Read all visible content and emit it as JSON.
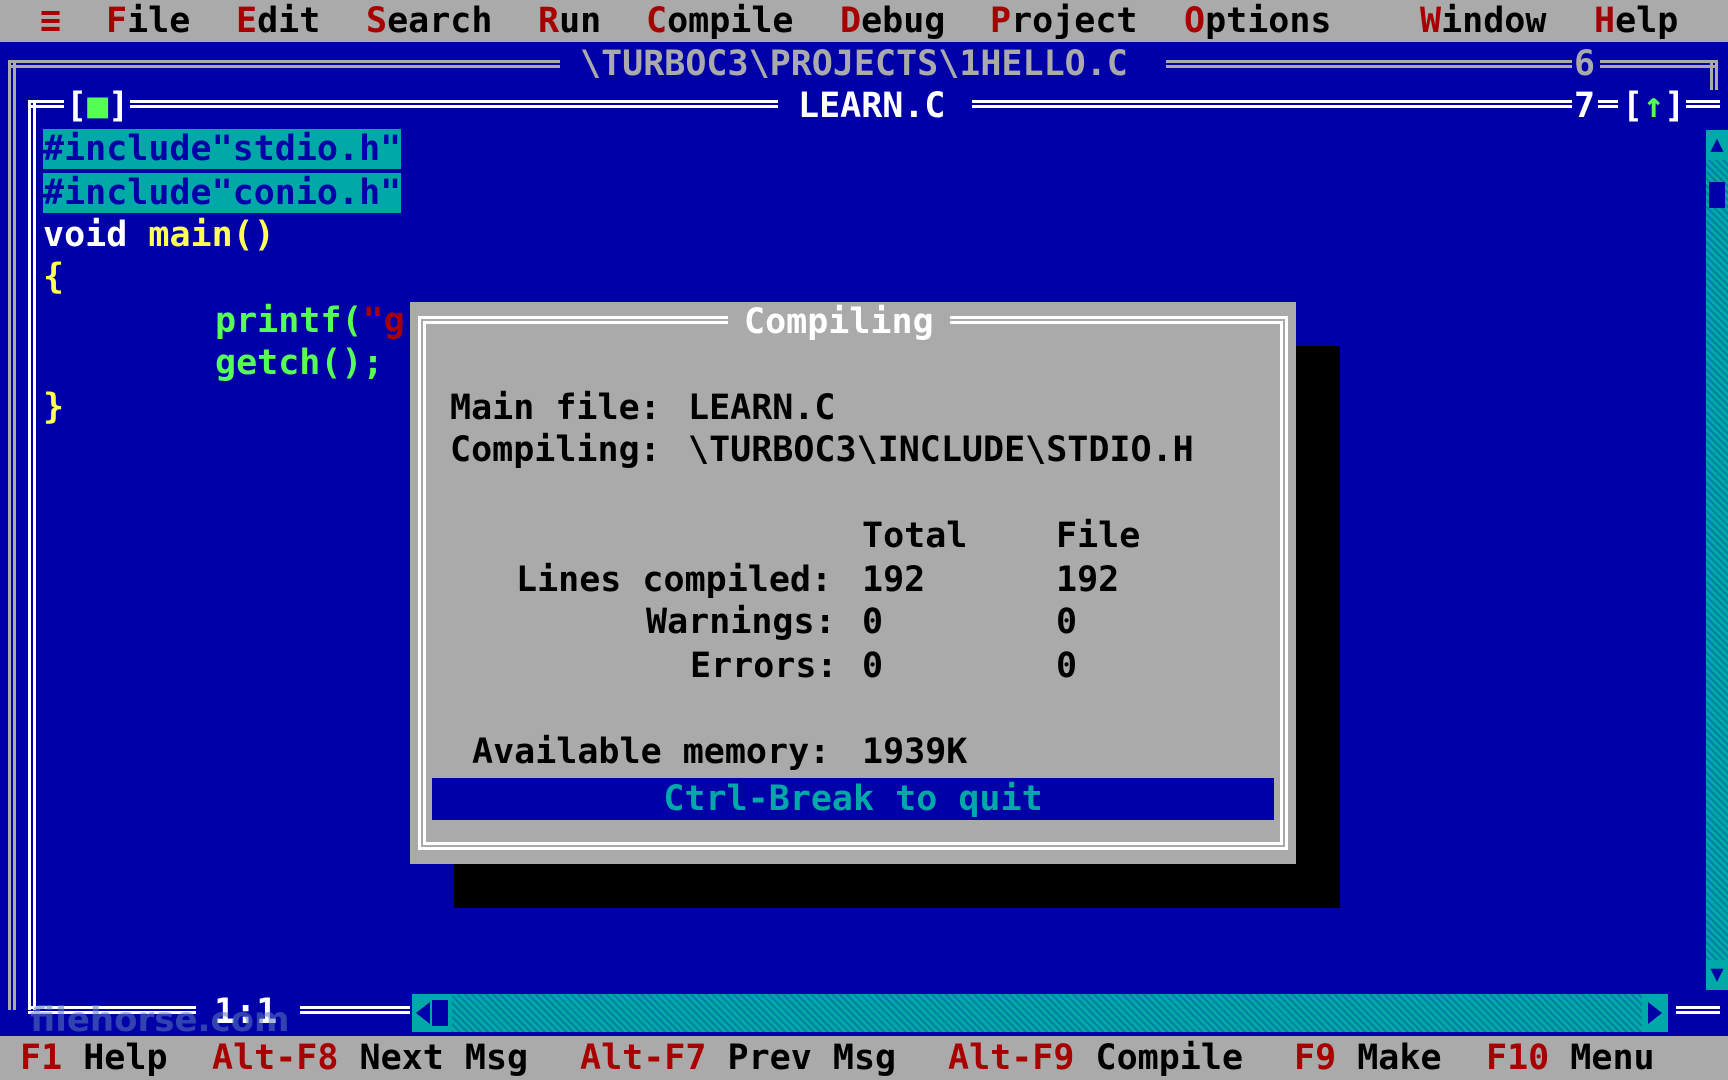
{
  "menu": {
    "system": "≡",
    "items": [
      {
        "hot": "F",
        "rest": "ile"
      },
      {
        "hot": "E",
        "rest": "dit"
      },
      {
        "hot": "S",
        "rest": "earch"
      },
      {
        "hot": "R",
        "rest": "un"
      },
      {
        "hot": "C",
        "rest": "ompile"
      },
      {
        "hot": "D",
        "rest": "ebug"
      },
      {
        "hot": "P",
        "rest": "roject"
      },
      {
        "hot": "O",
        "rest": "ptions"
      },
      {
        "hot": "W",
        "rest": "indow"
      },
      {
        "hot": "H",
        "rest": "elp"
      }
    ]
  },
  "back_window": {
    "title": "\\TURBOC3\\PROJECTS\\1HELLO.C",
    "number": "6"
  },
  "editor": {
    "close_box": "[■]",
    "title": "LEARN.C",
    "number": "7",
    "zoom_box": "[↑]",
    "cursor_pos": "1:1",
    "code": [
      {
        "text": "#include\"stdio.h\"",
        "selected": true
      },
      {
        "text": "#include\"conio.h\"",
        "selected": true
      },
      {
        "a": "void",
        "b": " main()"
      },
      {
        "text": "{"
      },
      {
        "a": "printf(",
        "b": "\"g"
      },
      {
        "text": "getch();"
      },
      {
        "text": "}"
      }
    ]
  },
  "dialog": {
    "title": "Compiling",
    "main_file_label": "Main file:",
    "main_file_value": "LEARN.C",
    "compiling_label": "Compiling:",
    "compiling_value": "\\TURBOC3\\INCLUDE\\STDIO.H",
    "col_total": "Total",
    "col_file": "File",
    "lines_label": "Lines compiled:",
    "lines_total": "192",
    "lines_file": "192",
    "warnings_label": "Warnings:",
    "warnings_total": "0",
    "warnings_file": "0",
    "errors_label": "Errors:",
    "errors_total": "0",
    "errors_file": "0",
    "memory_label": "Available memory:",
    "memory_value": "1939K",
    "quit_text": "Ctrl-Break to quit"
  },
  "statusbar": [
    {
      "key": "F1",
      "label": "Help"
    },
    {
      "key": "Alt-F8",
      "label": "Next Msg"
    },
    {
      "key": "Alt-F7",
      "label": "Prev Msg"
    },
    {
      "key": "Alt-F9",
      "label": "Compile"
    },
    {
      "key": "F9",
      "label": "Make"
    },
    {
      "key": "F10",
      "label": "Menu"
    }
  ],
  "watermark": "filehorse.com",
  "colors": {
    "desktop_blue": "#0000a8",
    "menu_gray": "#aaaaaa",
    "hotkey_red": "#a80000",
    "selection_cyan": "#00a8a8",
    "code_yellow": "#ffff55",
    "code_green": "#55ff55"
  }
}
